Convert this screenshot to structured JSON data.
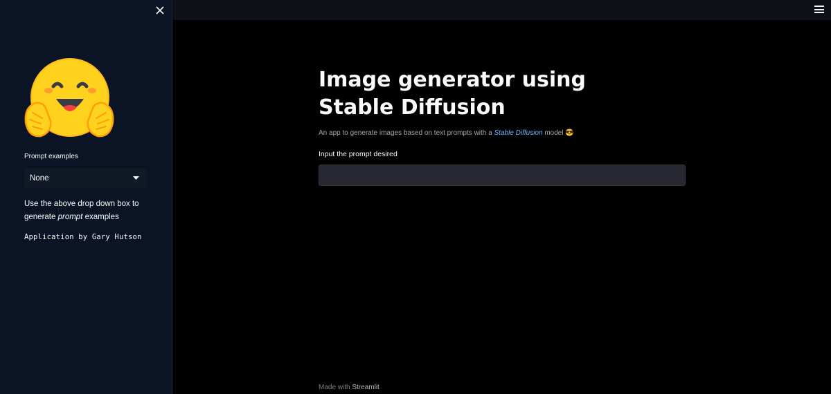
{
  "sidebar": {
    "prompt_examples_label": "Prompt examples",
    "select_value": "None",
    "help_before": "Use the above drop down box to generate ",
    "help_emph": "prompt",
    "help_after": " examples",
    "credit": "Application by Gary Hutson",
    "logo": "hugging-face-emoji"
  },
  "header": {
    "menu_icon": "hamburger-menu-icon",
    "close_icon": "close-icon"
  },
  "main": {
    "title": "Image generator using Stable Diffusion",
    "subtitle_before": "An app to generate images based on text prompts with a ",
    "subtitle_link": "Stable Diffusion",
    "subtitle_after": " model ",
    "subtitle_emoji": "😎",
    "input_label": "Input the prompt desired",
    "input_value": "",
    "input_placeholder": ""
  },
  "footer": {
    "made_with": "Made with ",
    "brand": "Streamlit"
  },
  "colors": {
    "sidebar_bg": "#0b1425",
    "main_bg": "#000000",
    "link": "#6eb6ff"
  }
}
